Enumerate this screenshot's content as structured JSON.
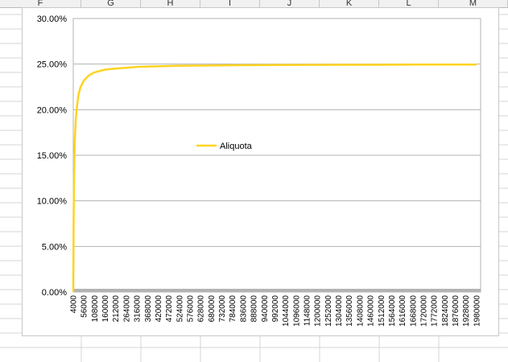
{
  "spreadsheet": {
    "columns": [
      "F",
      "G",
      "H",
      "I",
      "J",
      "K",
      "L",
      "M"
    ]
  },
  "chart_data": {
    "type": "line",
    "title": "",
    "xlabel": "",
    "ylabel": "",
    "x_tick_labels": [
      "4000",
      "56000",
      "108000",
      "160000",
      "212000",
      "264000",
      "316000",
      "368000",
      "420000",
      "472000",
      "524000",
      "576000",
      "628000",
      "680000",
      "732000",
      "784000",
      "836000",
      "888000",
      "940000",
      "992000",
      "1044000",
      "1096000",
      "1148000",
      "1200000",
      "1252000",
      "1304000",
      "1356000",
      "1408000",
      "1460000",
      "1512000",
      "1564000",
      "1616000",
      "1668000",
      "1720000",
      "1772000",
      "1824000",
      "1876000",
      "1928000",
      "1980000"
    ],
    "y_tick_labels": [
      "0.00%",
      "5.00%",
      "10.00%",
      "15.00%",
      "20.00%",
      "25.00%",
      "30.00%"
    ],
    "ylim": [
      0,
      30
    ],
    "xlim": [
      4000,
      2000000
    ],
    "grid": true,
    "legend_position": "center",
    "series": [
      {
        "name": "Aliquota",
        "color": "#ffd320",
        "x": [
          4000,
          6000,
          8000,
          10000,
          12000,
          16000,
          20000,
          30000,
          40000,
          56000,
          80000,
          108000,
          160000,
          212000,
          264000,
          316000,
          420000,
          524000,
          628000,
          732000,
          836000,
          940000,
          1044000,
          1200000,
          1356000,
          1512000,
          1668000,
          1824000,
          1980000
        ],
        "values": [
          0.0,
          8.3,
          12.5,
          15.0,
          16.7,
          18.75,
          20.0,
          21.7,
          22.5,
          23.2,
          23.75,
          24.1,
          24.4,
          24.5,
          24.6,
          24.7,
          24.76,
          24.81,
          24.84,
          24.86,
          24.88,
          24.89,
          24.9,
          24.92,
          24.93,
          24.93,
          24.94,
          24.95,
          24.95
        ]
      }
    ]
  }
}
